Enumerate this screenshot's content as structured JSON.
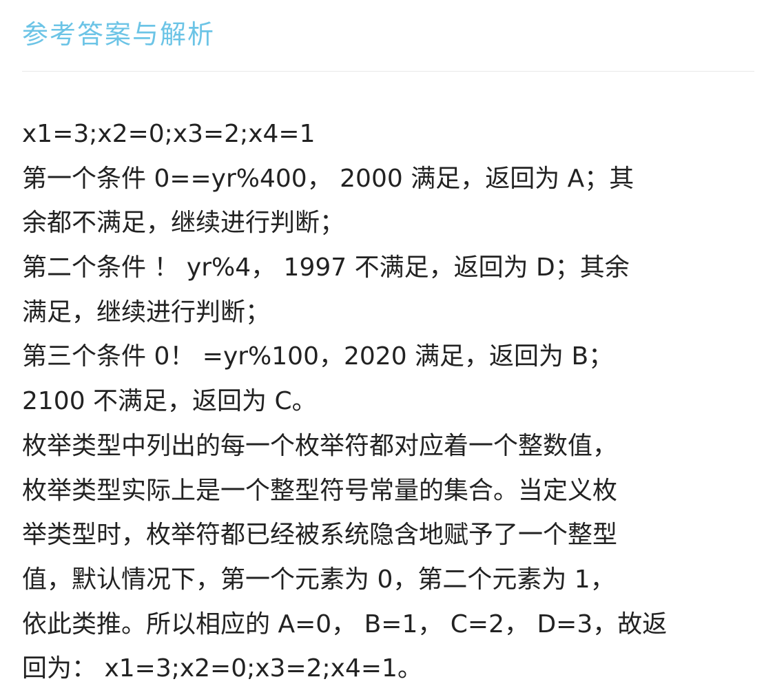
{
  "header": {
    "title": "参考答案与解析"
  },
  "content": {
    "lines": [
      "x1=3;x2=0;x3=2;x4=1",
      "第一个条件 0==yr%400， 2000 满足，返回为 A；其",
      "余都不满足，继续进行判断；",
      "第二个条件 ！ yr%4， 1997 不满足，返回为 D；其余",
      "满足，继续进行判断；",
      "第三个条件 0！ =yr%100，2020 满足，返回为 B；",
      "2100 不满足，返回为 C。",
      "枚举类型中列出的每一个枚举符都对应着一个整数值，",
      "枚举类型实际上是一个整型符号常量的集合。当定义枚",
      "举类型时，枚举符都已经被系统隐含地赋予了一个整型",
      "值，默认情况下，第一个元素为 0，第二个元素为 1，",
      "依此类推。所以相应的 A=0， B=1， C=2， D=3，故返",
      "回为： x1=3;x2=0;x3=2;x4=1。"
    ]
  }
}
